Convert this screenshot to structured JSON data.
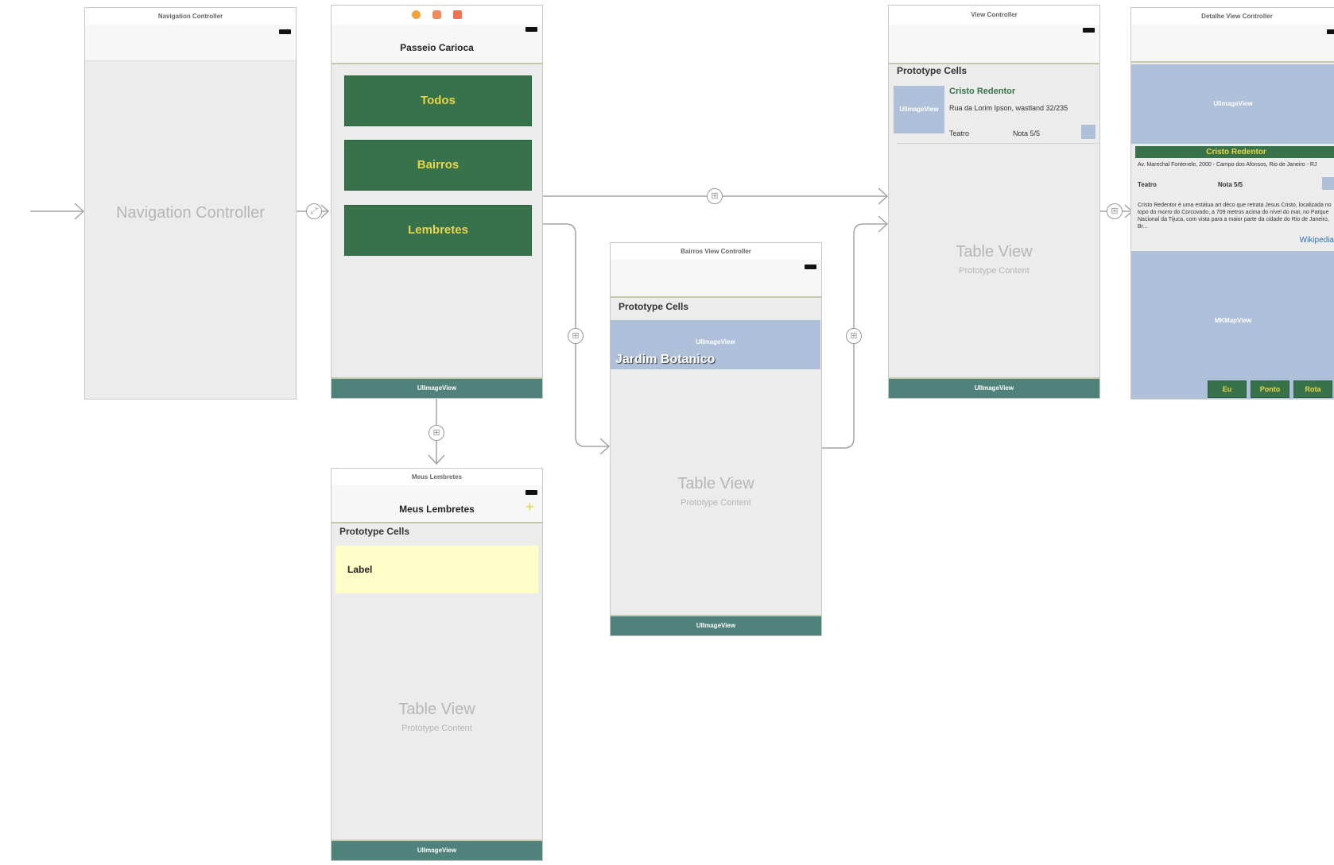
{
  "nav_controller": {
    "title": "Navigation Controller",
    "center_label": "Navigation Controller"
  },
  "home": {
    "title_icons": [
      "controller-icon",
      "first-responder-icon",
      "exit-icon"
    ],
    "nav_title": "Passeio Carioca",
    "buttons": [
      "Todos",
      "Bairros",
      "Lembretes"
    ],
    "bottom": "UIImageView"
  },
  "lembretes": {
    "title": "Meus Lembretes",
    "nav_title": "Meus Lembretes",
    "add_icon": "+",
    "proto_header": "Prototype Cells",
    "cell_label": "Label",
    "table_title": "Table View",
    "table_sub": "Prototype Content",
    "bottom": "UIImageView"
  },
  "bairros": {
    "title": "Bairros View Controller",
    "proto_header": "Prototype Cells",
    "image_placeholder": "UIImageView",
    "cell_title": "Jardim Botanico",
    "table_title": "Table View",
    "table_sub": "Prototype Content",
    "bottom": "UIImageView"
  },
  "view_controller": {
    "title": "View Controller",
    "proto_header": "Prototype Cells",
    "image_placeholder": "UIImageView",
    "cell_title": "Cristo Redentor",
    "cell_address": "Rua da Lorim Ipson, wastland 32/235",
    "cell_category": "Teatro",
    "cell_rating": "Nota 5/5",
    "table_title": "Table View",
    "table_sub": "Prototype Content",
    "bottom": "UIImageView"
  },
  "detalhe": {
    "title": "Detalhe View Controller",
    "image_placeholder": "UIImageView",
    "name": "Cristo Redentor",
    "address": "Av. Marechal Fontenele, 2000 - Campo dos Afonsos, Rio de Janeiro - RJ",
    "category": "Teatro",
    "rating": "Nota 5/5",
    "description": "Cristo Redentor é uma estátua art déco que retrata Jesus Cristo, localizada no topo do morro do Corcovado, a 709 metros acima do nível do mar, no Parque Nacional da Tijuca, com vista para a maior parte da cidade do Rio de Janeiro, Br...",
    "link": "Wikipedia",
    "map_placeholder": "MKMapView",
    "buttons": [
      "Eu",
      "Ponto",
      "Rota"
    ]
  },
  "colors": {
    "canvas": "#ffffff",
    "scene_bg": "#ececec",
    "button_green": "#37724a",
    "button_text": "#e8d54a",
    "bottom_bar": "#4f827b",
    "placeholder": "#aec0da",
    "cell_yellow": "#fffdc8",
    "segue_line": "#999999"
  }
}
